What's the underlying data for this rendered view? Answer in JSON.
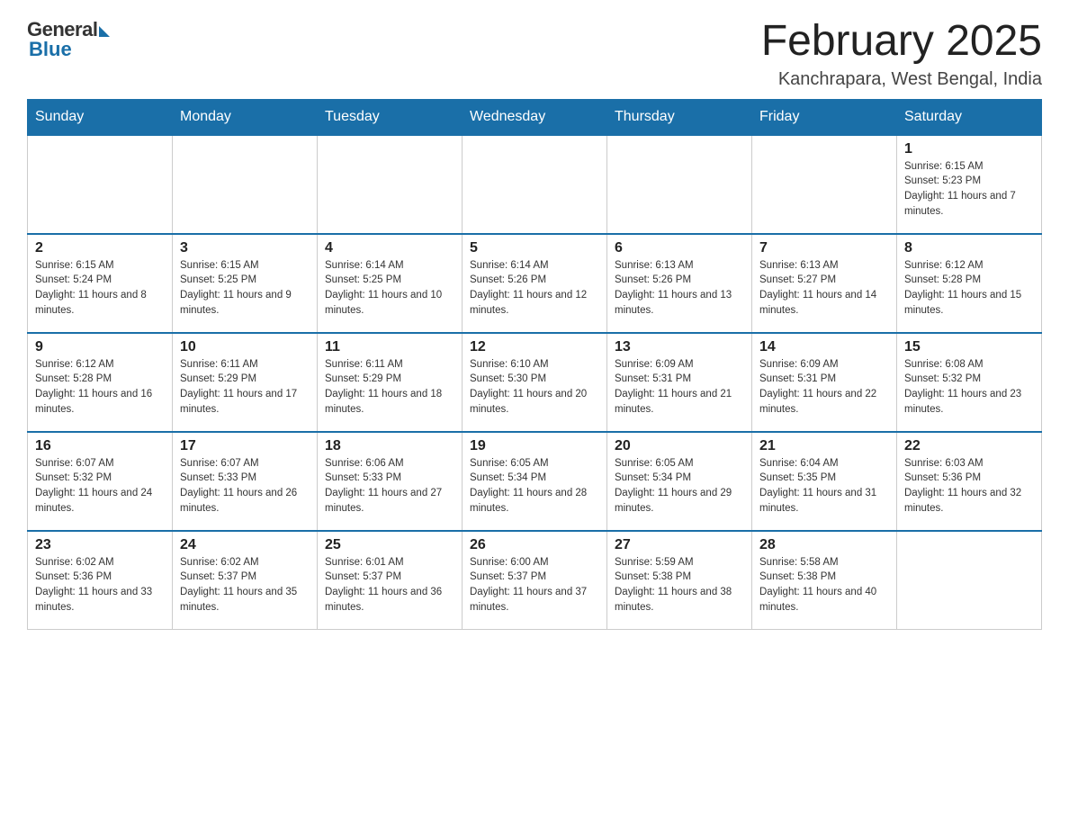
{
  "logo": {
    "general": "General",
    "blue": "Blue"
  },
  "title": "February 2025",
  "location": "Kanchrapara, West Bengal, India",
  "weekdays": [
    "Sunday",
    "Monday",
    "Tuesday",
    "Wednesday",
    "Thursday",
    "Friday",
    "Saturday"
  ],
  "weeks": [
    [
      {
        "day": "",
        "info": ""
      },
      {
        "day": "",
        "info": ""
      },
      {
        "day": "",
        "info": ""
      },
      {
        "day": "",
        "info": ""
      },
      {
        "day": "",
        "info": ""
      },
      {
        "day": "",
        "info": ""
      },
      {
        "day": "1",
        "info": "Sunrise: 6:15 AM\nSunset: 5:23 PM\nDaylight: 11 hours and 7 minutes."
      }
    ],
    [
      {
        "day": "2",
        "info": "Sunrise: 6:15 AM\nSunset: 5:24 PM\nDaylight: 11 hours and 8 minutes."
      },
      {
        "day": "3",
        "info": "Sunrise: 6:15 AM\nSunset: 5:25 PM\nDaylight: 11 hours and 9 minutes."
      },
      {
        "day": "4",
        "info": "Sunrise: 6:14 AM\nSunset: 5:25 PM\nDaylight: 11 hours and 10 minutes."
      },
      {
        "day": "5",
        "info": "Sunrise: 6:14 AM\nSunset: 5:26 PM\nDaylight: 11 hours and 12 minutes."
      },
      {
        "day": "6",
        "info": "Sunrise: 6:13 AM\nSunset: 5:26 PM\nDaylight: 11 hours and 13 minutes."
      },
      {
        "day": "7",
        "info": "Sunrise: 6:13 AM\nSunset: 5:27 PM\nDaylight: 11 hours and 14 minutes."
      },
      {
        "day": "8",
        "info": "Sunrise: 6:12 AM\nSunset: 5:28 PM\nDaylight: 11 hours and 15 minutes."
      }
    ],
    [
      {
        "day": "9",
        "info": "Sunrise: 6:12 AM\nSunset: 5:28 PM\nDaylight: 11 hours and 16 minutes."
      },
      {
        "day": "10",
        "info": "Sunrise: 6:11 AM\nSunset: 5:29 PM\nDaylight: 11 hours and 17 minutes."
      },
      {
        "day": "11",
        "info": "Sunrise: 6:11 AM\nSunset: 5:29 PM\nDaylight: 11 hours and 18 minutes."
      },
      {
        "day": "12",
        "info": "Sunrise: 6:10 AM\nSunset: 5:30 PM\nDaylight: 11 hours and 20 minutes."
      },
      {
        "day": "13",
        "info": "Sunrise: 6:09 AM\nSunset: 5:31 PM\nDaylight: 11 hours and 21 minutes."
      },
      {
        "day": "14",
        "info": "Sunrise: 6:09 AM\nSunset: 5:31 PM\nDaylight: 11 hours and 22 minutes."
      },
      {
        "day": "15",
        "info": "Sunrise: 6:08 AM\nSunset: 5:32 PM\nDaylight: 11 hours and 23 minutes."
      }
    ],
    [
      {
        "day": "16",
        "info": "Sunrise: 6:07 AM\nSunset: 5:32 PM\nDaylight: 11 hours and 24 minutes."
      },
      {
        "day": "17",
        "info": "Sunrise: 6:07 AM\nSunset: 5:33 PM\nDaylight: 11 hours and 26 minutes."
      },
      {
        "day": "18",
        "info": "Sunrise: 6:06 AM\nSunset: 5:33 PM\nDaylight: 11 hours and 27 minutes."
      },
      {
        "day": "19",
        "info": "Sunrise: 6:05 AM\nSunset: 5:34 PM\nDaylight: 11 hours and 28 minutes."
      },
      {
        "day": "20",
        "info": "Sunrise: 6:05 AM\nSunset: 5:34 PM\nDaylight: 11 hours and 29 minutes."
      },
      {
        "day": "21",
        "info": "Sunrise: 6:04 AM\nSunset: 5:35 PM\nDaylight: 11 hours and 31 minutes."
      },
      {
        "day": "22",
        "info": "Sunrise: 6:03 AM\nSunset: 5:36 PM\nDaylight: 11 hours and 32 minutes."
      }
    ],
    [
      {
        "day": "23",
        "info": "Sunrise: 6:02 AM\nSunset: 5:36 PM\nDaylight: 11 hours and 33 minutes."
      },
      {
        "day": "24",
        "info": "Sunrise: 6:02 AM\nSunset: 5:37 PM\nDaylight: 11 hours and 35 minutes."
      },
      {
        "day": "25",
        "info": "Sunrise: 6:01 AM\nSunset: 5:37 PM\nDaylight: 11 hours and 36 minutes."
      },
      {
        "day": "26",
        "info": "Sunrise: 6:00 AM\nSunset: 5:37 PM\nDaylight: 11 hours and 37 minutes."
      },
      {
        "day": "27",
        "info": "Sunrise: 5:59 AM\nSunset: 5:38 PM\nDaylight: 11 hours and 38 minutes."
      },
      {
        "day": "28",
        "info": "Sunrise: 5:58 AM\nSunset: 5:38 PM\nDaylight: 11 hours and 40 minutes."
      },
      {
        "day": "",
        "info": ""
      }
    ]
  ]
}
